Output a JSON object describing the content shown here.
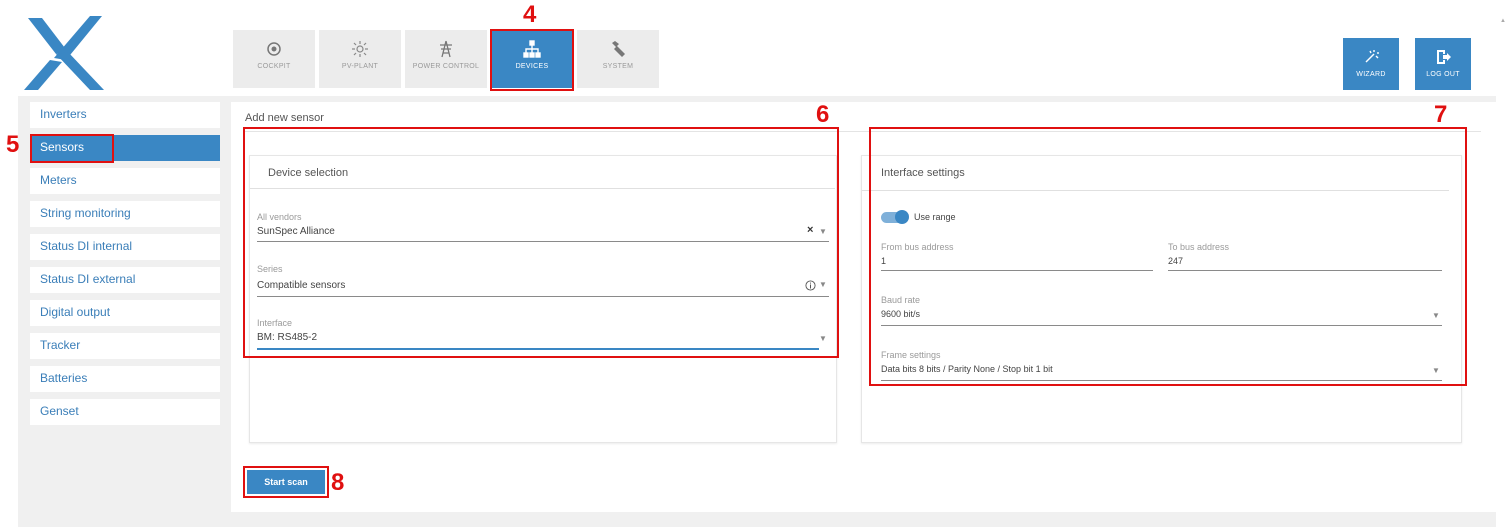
{
  "header": {
    "nav": [
      {
        "label": "COCKPIT",
        "icon": "target-icon"
      },
      {
        "label": "PV-PLANT",
        "icon": "sun-icon"
      },
      {
        "label": "POWER CONTROL",
        "icon": "power-tower-icon"
      },
      {
        "label": "DEVICES",
        "icon": "network-icon",
        "active": true
      },
      {
        "label": "SYSTEM",
        "icon": "wrench-icon"
      }
    ],
    "wizard_label": "WIZARD",
    "logout_label": "LOG OUT"
  },
  "sidebar": {
    "items": [
      {
        "label": "Inverters"
      },
      {
        "label": "Sensors",
        "active": true
      },
      {
        "label": "Meters"
      },
      {
        "label": "String monitoring"
      },
      {
        "label": "Status DI internal"
      },
      {
        "label": "Status DI external"
      },
      {
        "label": "Digital output"
      },
      {
        "label": "Tracker"
      },
      {
        "label": "Batteries"
      },
      {
        "label": "Genset"
      }
    ]
  },
  "main": {
    "title": "Add new sensor",
    "device_selection": {
      "title": "Device selection",
      "vendor": {
        "label": "All vendors",
        "value": "SunSpec Alliance"
      },
      "series": {
        "label": "Series",
        "value": "Compatible sensors"
      },
      "interface": {
        "label": "Interface",
        "value": "BM: RS485-2"
      }
    },
    "interface_settings": {
      "title": "Interface settings",
      "use_range_label": "Use range",
      "use_range_on": true,
      "from_bus": {
        "label": "From bus address",
        "value": "1"
      },
      "to_bus": {
        "label": "To bus address",
        "value": "247"
      },
      "baud_rate": {
        "label": "Baud rate",
        "value": "9600 bit/s"
      },
      "frame": {
        "label": "Frame settings",
        "value": "Data bits 8 bits / Parity None / Stop bit 1 bit"
      }
    },
    "start_scan_label": "Start scan"
  },
  "annotations": {
    "nav": "4",
    "sidebar": "5",
    "device_selection": "6",
    "interface_settings": "7",
    "start_scan": "8"
  },
  "colors": {
    "accent": "#3a87c4",
    "annotation": "#e01010"
  }
}
